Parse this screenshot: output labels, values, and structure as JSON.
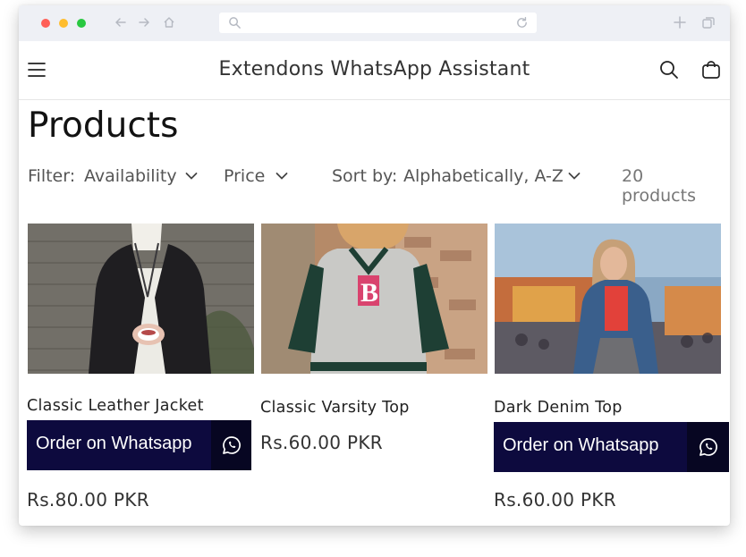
{
  "browser": {
    "controls": [
      "close-dot",
      "minimize-dot",
      "zoom-dot"
    ],
    "icons": [
      "back-arrow-icon",
      "forward-arrow-icon",
      "home-icon",
      "search-icon",
      "reload-icon",
      "new-tab-plus-icon",
      "tabs-icon"
    ]
  },
  "header": {
    "title": "Extendons WhatsApp Assistant",
    "icons": [
      "hamburger-menu-icon",
      "search-icon",
      "shopping-bag-icon"
    ]
  },
  "page": {
    "title": "Products"
  },
  "facets": {
    "filter_label": "Filter:",
    "availability": "Availability",
    "price": "Price",
    "sort_label": "Sort by:",
    "sort_value": "Alphabetically, A-Z",
    "product_count": "20 products"
  },
  "products": [
    {
      "title": "Classic Leather Jacket",
      "price": "Rs.80.00 PKR",
      "button": "Order on Whatsapp",
      "image": "woman-in-black-leather-jacket-holding-tea-cup"
    },
    {
      "title": "Classic Varsity Top",
      "price": "Rs.60.00 PKR",
      "image": "woman-in-grey-varsity-jacket-against-brick-wall"
    },
    {
      "title": "Dark Denim Top",
      "price": "Rs.60.00 PKR",
      "button": "Order on Whatsapp",
      "image": "woman-in-denim-jacket-at-carnival"
    }
  ],
  "colors": {
    "whatsapp_button": "#0d0a3e",
    "whatsapp_icon_box": "#070622",
    "text": "#333333"
  }
}
